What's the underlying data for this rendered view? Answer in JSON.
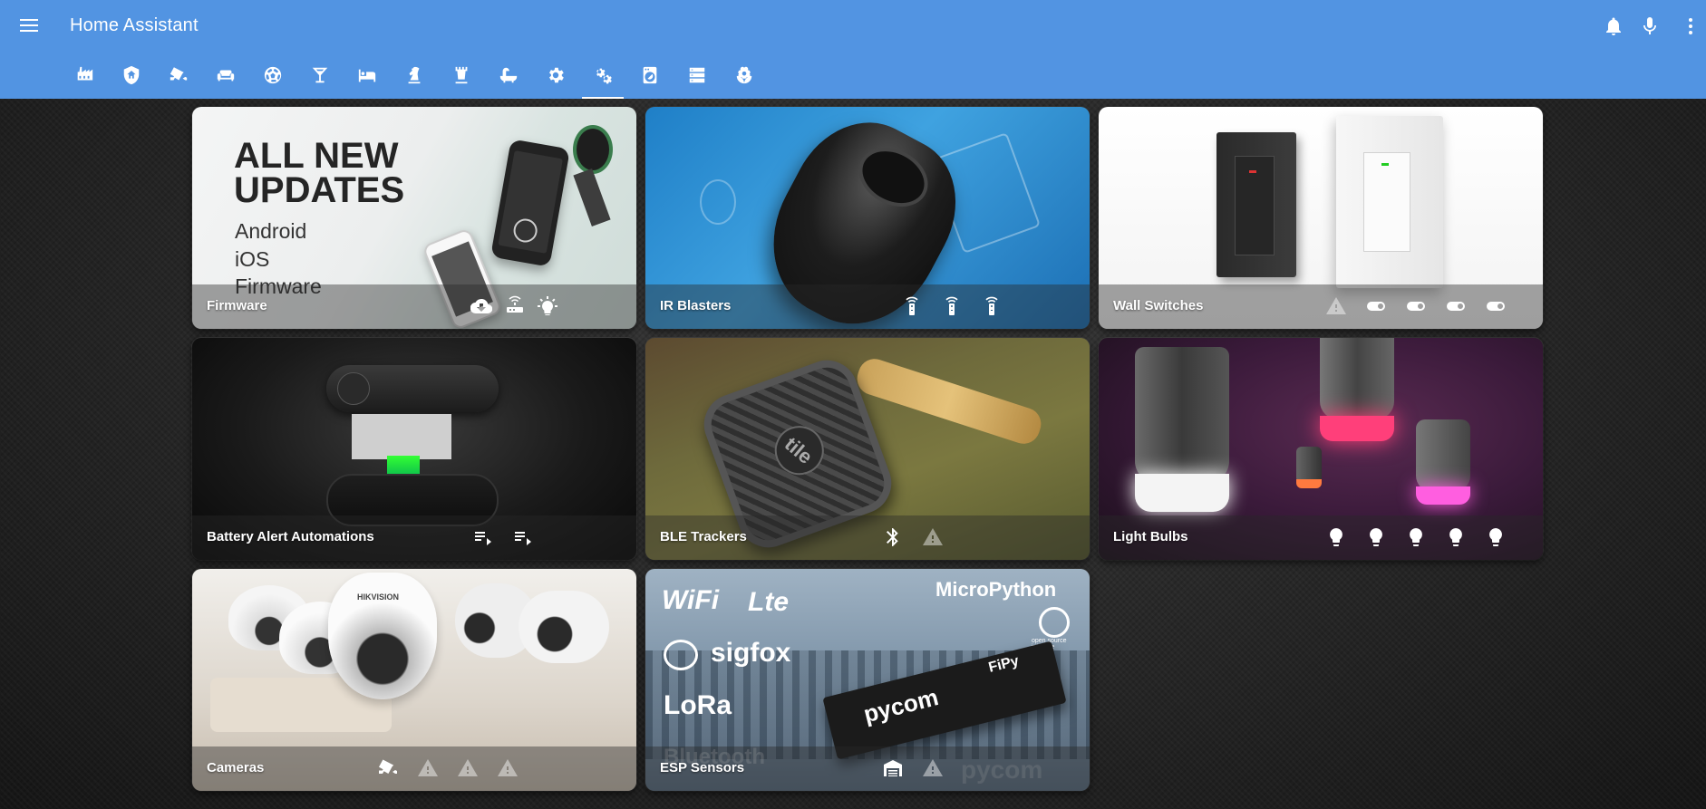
{
  "app": {
    "title": "Home Assistant",
    "colors": {
      "header": "#5294e2",
      "card_footer": "rgba(40,40,40,0.42)"
    }
  },
  "header_actions": [
    {
      "name": "bell-icon"
    },
    {
      "name": "microphone-icon"
    },
    {
      "name": "more-vertical-icon"
    }
  ],
  "tabs": [
    {
      "name": "tab-factory",
      "icon": "factory-icon"
    },
    {
      "name": "tab-security",
      "icon": "shield-home-icon"
    },
    {
      "name": "tab-cctv",
      "icon": "cctv-icon"
    },
    {
      "name": "tab-living-room",
      "icon": "sofa-icon"
    },
    {
      "name": "tab-soccer",
      "icon": "soccer-icon"
    },
    {
      "name": "tab-bar",
      "icon": "glass-cocktail-icon"
    },
    {
      "name": "tab-bedroom",
      "icon": "bed-icon"
    },
    {
      "name": "tab-chess-knight",
      "icon": "chess-knight-icon"
    },
    {
      "name": "tab-chess-rook",
      "icon": "chess-rook-icon"
    },
    {
      "name": "tab-bathroom",
      "icon": "bathtub-icon"
    },
    {
      "name": "tab-settings",
      "icon": "gear-icon"
    },
    {
      "name": "tab-devices",
      "icon": "settings-multiple-icon",
      "active": true
    },
    {
      "name": "tab-washing",
      "icon": "washing-machine-icon"
    },
    {
      "name": "tab-server",
      "icon": "server-icon"
    },
    {
      "name": "tab-garden",
      "icon": "flower-icon"
    }
  ],
  "cards": [
    {
      "title": "Firmware",
      "art": {
        "headline1": "ALL NEW",
        "headline2": "UPDATES",
        "line1": "Android",
        "line2": "iOS",
        "line3": "Firmware"
      },
      "icons": [
        "cloud-download-icon",
        "router-wireless-icon",
        "lightbulb-on-icon"
      ]
    },
    {
      "title": "IR Blasters",
      "icons": [
        "remote-icon",
        "remote-icon",
        "remote-icon"
      ]
    },
    {
      "title": "Wall Switches",
      "icons": [
        "alert-icon",
        "toggle-switch-icon",
        "toggle-switch-icon",
        "toggle-switch-icon",
        "toggle-switch-icon"
      ]
    },
    {
      "title": "Battery Alert Automations",
      "icons": [
        "playlist-play-icon",
        "playlist-play-icon"
      ]
    },
    {
      "title": "BLE Trackers",
      "art": {
        "brand": "tile"
      },
      "icons": [
        "bluetooth-icon",
        "alert-icon"
      ]
    },
    {
      "title": "Light Bulbs",
      "icons": [
        "lightbulb-icon",
        "lightbulb-icon",
        "lightbulb-icon",
        "lightbulb-icon",
        "lightbulb-icon"
      ]
    },
    {
      "title": "Cameras",
      "art": {
        "brand": "HIKVISION"
      },
      "icons": [
        "cctv-icon",
        "alert-icon",
        "alert-icon",
        "alert-icon"
      ]
    },
    {
      "title": "ESP Sensors",
      "art": {
        "wifi": "WiFi",
        "lte": "Lte",
        "sigfox": "sigfox",
        "lora": "LoRa",
        "micropython": "MicroPython",
        "pycom": "pycom",
        "bluetooth": "Bluetooth",
        "fipy": "FiPy",
        "osi": "open source initiative",
        "pycom_footer": "pycom"
      },
      "icons": [
        "garage-icon",
        "alert-icon"
      ]
    }
  ]
}
